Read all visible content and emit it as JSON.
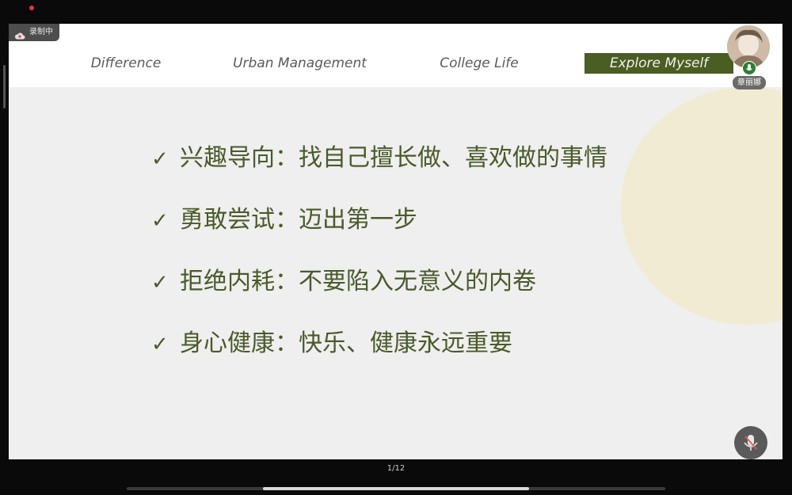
{
  "recording": {
    "label": "录制中"
  },
  "slide": {
    "nav_tabs": [
      {
        "label": "Difference",
        "active": false
      },
      {
        "label": "Urban Management",
        "active": false
      },
      {
        "label": "College Life",
        "active": false
      },
      {
        "label": "Explore Myself",
        "active": true
      }
    ],
    "bullets": [
      {
        "check": "✓",
        "text": "兴趣导向：找自己擅长做、喜欢做的事情"
      },
      {
        "check": "✓",
        "text": "勇敢尝试：迈出第一步"
      },
      {
        "check": "✓",
        "text": "拒绝内耗：不要陷入无意义的内卷"
      },
      {
        "check": "✓",
        "text": "身心健康：快乐、健康永远重要"
      }
    ]
  },
  "participant": {
    "name": "章丽娜"
  },
  "pagination": {
    "current": 1,
    "total": 12,
    "label": "1/12"
  },
  "colors": {
    "accent": "#4a5d23",
    "bullet_text": "#4a5a2a",
    "deco_circle": "#f0ebd2"
  },
  "icons": {
    "recording": "cloud-icon",
    "mic": "microphone-off-icon",
    "avatar_status": "mic-active-icon"
  }
}
